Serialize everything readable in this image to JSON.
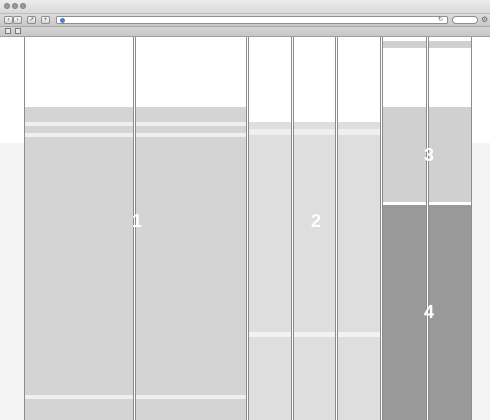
{
  "browser": {
    "toolbar": {
      "reload_glyph": "↻",
      "settings_glyph": "⚙",
      "back_icon": "arrow-left-icon",
      "forward_icon": "arrow-right-icon"
    }
  },
  "wireframe": {
    "regions": [
      {
        "id": "region-1",
        "label": "1"
      },
      {
        "id": "region-2",
        "label": "2"
      },
      {
        "id": "region-3",
        "label": "3"
      },
      {
        "id": "region-4",
        "label": "4"
      }
    ]
  },
  "colors": {
    "light_block": "#d2d2d2",
    "medium_block": "#dddddd",
    "dark_block": "#999999",
    "background": "#f4f4f4"
  }
}
